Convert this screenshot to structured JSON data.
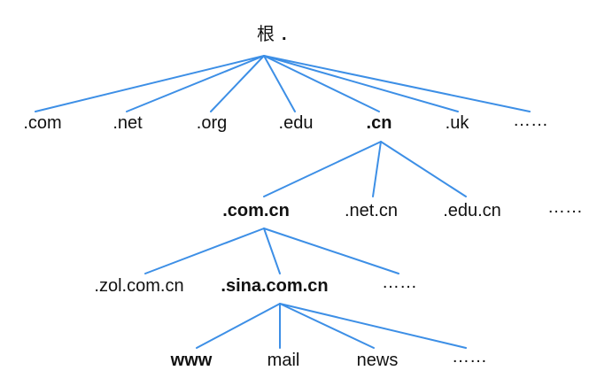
{
  "diagram": {
    "root": {
      "label": "根",
      "dot": "."
    },
    "tld": [
      ".com",
      ".net",
      ".org",
      ".edu",
      ".cn",
      ".uk",
      "……"
    ],
    "cn_children": [
      ".com.cn",
      ".net.cn",
      ".edu.cn",
      "……"
    ],
    "comcn_children": [
      ".zol.com.cn",
      ".sina.com.cn",
      "……"
    ],
    "sina_children": [
      "www",
      "mail",
      "news",
      "……"
    ]
  },
  "colors": {
    "edge": "#3d8fe6",
    "text": "#111111"
  }
}
